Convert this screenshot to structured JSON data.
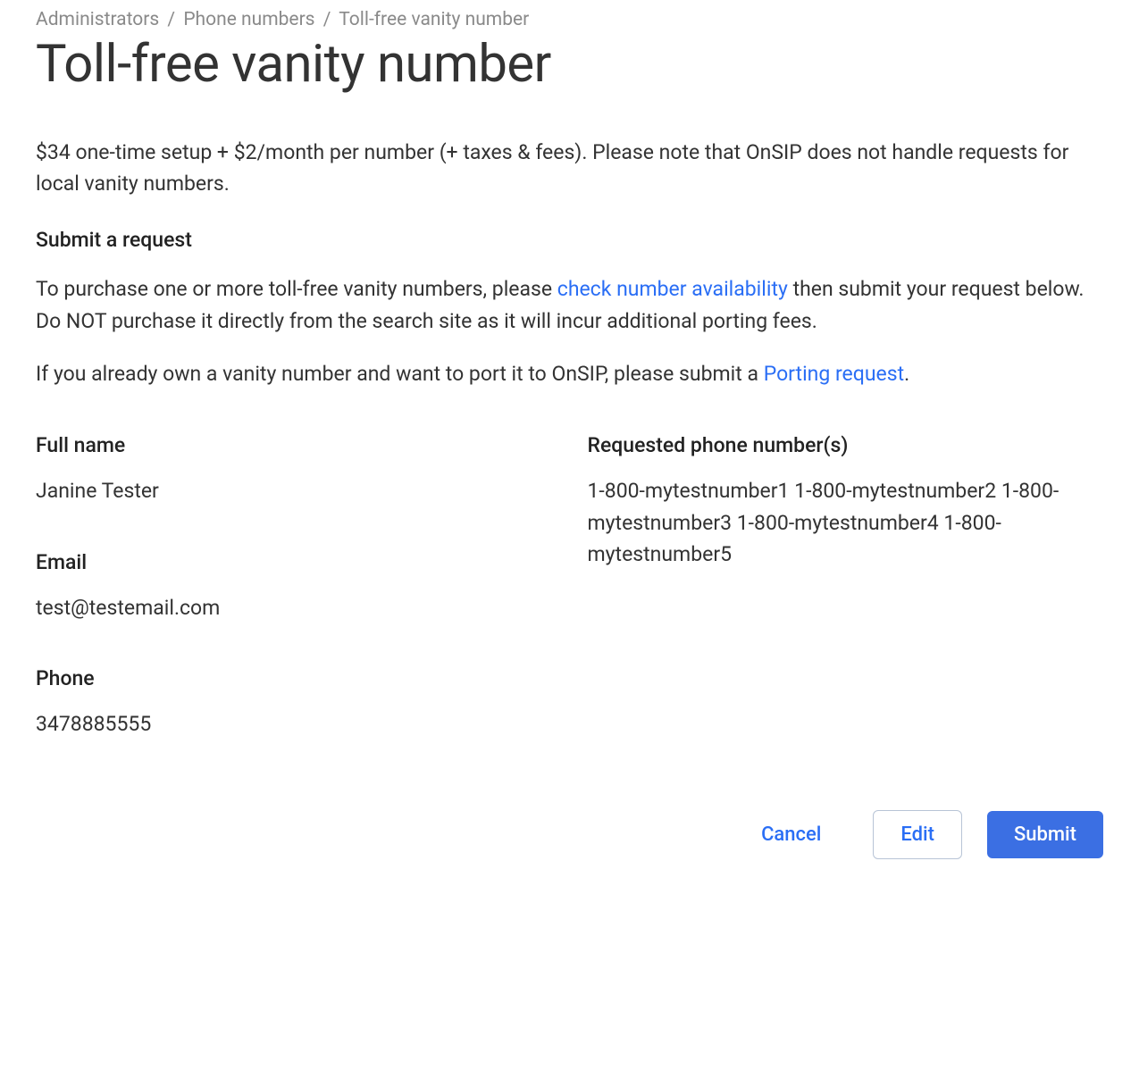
{
  "breadcrumb": {
    "items": [
      "Administrators",
      "Phone numbers",
      "Toll-free vanity number"
    ],
    "separator": "/"
  },
  "page_title": "Toll-free vanity number",
  "description": "$34 one-time setup + $2/month per number (+ taxes & fees). Please note that OnSIP does not handle requests for local vanity numbers.",
  "section_heading": "Submit a request",
  "instructions": {
    "para1_pre": "To purchase one or more toll-free vanity numbers, please ",
    "para1_link": "check number availability",
    "para1_post": " then submit your request below. Do NOT purchase it directly from the search site as it will incur additional porting fees.",
    "para2_pre": "If you already own a vanity number and want to port it to OnSIP, please submit a ",
    "para2_link": "Porting request",
    "para2_post": "."
  },
  "fields": {
    "full_name": {
      "label": "Full name",
      "value": "Janine Tester"
    },
    "email": {
      "label": "Email",
      "value": "test@testemail.com"
    },
    "phone": {
      "label": "Phone",
      "value": "3478885555"
    },
    "requested_numbers": {
      "label": "Requested phone number(s)",
      "value": "1-800-mytestnumber1 1-800-mytestnumber2 1-800-mytestnumber3 1-800-mytestnumber4 1-800-mytestnumber5"
    }
  },
  "actions": {
    "cancel": "Cancel",
    "edit": "Edit",
    "submit": "Submit"
  }
}
